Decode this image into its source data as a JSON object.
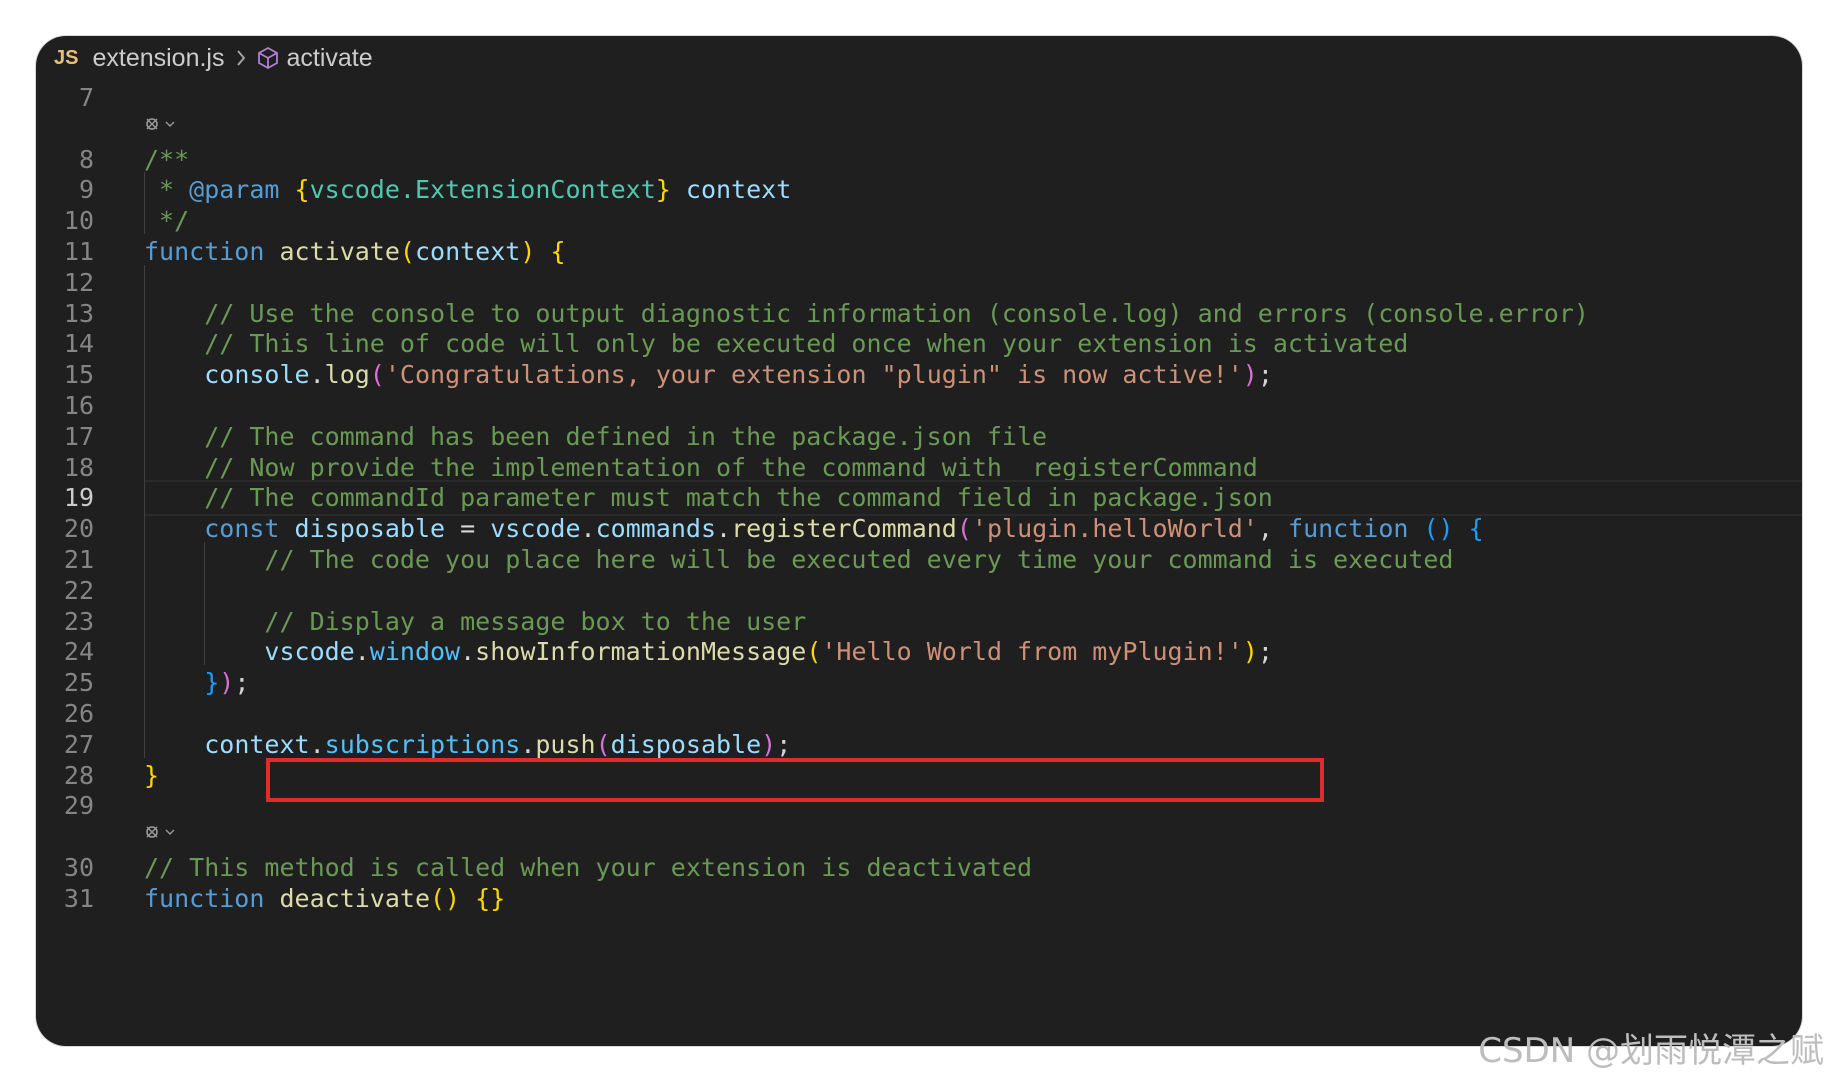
{
  "breadcrumb": {
    "badge": "JS",
    "file": "extension.js",
    "separator": "›",
    "symbol": "activate",
    "symbol_icon": "cube-icon"
  },
  "colors": {
    "background": "#1f1f1f",
    "comment": "#6a9955",
    "keyword": "#569cd6",
    "function": "#dcdcaa",
    "variable": "#9cdcfe",
    "string": "#ce9178",
    "type": "#4ec9b0",
    "highlight_box": "#e12a2a"
  },
  "codelens_icon": "codelens-icon",
  "lines": [
    {
      "n": "7",
      "tokens": []
    },
    {
      "n": "8",
      "tokens": [
        [
          "c-comment",
          "/**"
        ]
      ]
    },
    {
      "n": "9",
      "tokens": [
        [
          "c-comment",
          " * "
        ],
        [
          "c-kw",
          "@param"
        ],
        [
          "c-comment",
          " "
        ],
        [
          "c-p1",
          "{"
        ],
        [
          "c-type",
          "vscode.ExtensionContext"
        ],
        [
          "c-p1",
          "}"
        ],
        [
          "c-comment",
          " "
        ],
        [
          "c-var",
          "context"
        ]
      ]
    },
    {
      "n": "10",
      "tokens": [
        [
          "c-comment",
          " */"
        ]
      ]
    },
    {
      "n": "11",
      "tokens": [
        [
          "c-kw",
          "function"
        ],
        [
          "c-plain",
          " "
        ],
        [
          "c-fn",
          "activate"
        ],
        [
          "c-p1",
          "("
        ],
        [
          "c-var",
          "context"
        ],
        [
          "c-p1",
          ")"
        ],
        [
          "c-plain",
          " "
        ],
        [
          "c-p1",
          "{"
        ]
      ]
    },
    {
      "n": "12",
      "tokens": []
    },
    {
      "n": "13",
      "tokens": [
        [
          "c-plain",
          "    "
        ],
        [
          "c-comment",
          "// Use the console to output diagnostic information (console.log) and errors (console.error)"
        ]
      ]
    },
    {
      "n": "14",
      "tokens": [
        [
          "c-plain",
          "    "
        ],
        [
          "c-comment",
          "// This line of code will only be executed once when your extension is activated"
        ]
      ]
    },
    {
      "n": "15",
      "tokens": [
        [
          "c-plain",
          "    "
        ],
        [
          "c-var",
          "console"
        ],
        [
          "c-plain",
          "."
        ],
        [
          "c-fn",
          "log"
        ],
        [
          "c-p2",
          "("
        ],
        [
          "c-str",
          "'Congratulations, your extension \"plugin\" is now active!'"
        ],
        [
          "c-p2",
          ")"
        ],
        [
          "c-plain",
          ";"
        ]
      ]
    },
    {
      "n": "16",
      "tokens": []
    },
    {
      "n": "17",
      "tokens": [
        [
          "c-plain",
          "    "
        ],
        [
          "c-comment",
          "// The command has been defined in the package.json file"
        ]
      ]
    },
    {
      "n": "18",
      "tokens": [
        [
          "c-plain",
          "    "
        ],
        [
          "c-comment",
          "// Now provide the implementation of the command with  registerCommand"
        ]
      ]
    },
    {
      "n": "19",
      "tokens": [
        [
          "c-plain",
          "    "
        ],
        [
          "c-comment",
          "// The commandId parameter must match the command field in package.json"
        ]
      ],
      "active": true
    },
    {
      "n": "20",
      "tokens": [
        [
          "c-plain",
          "    "
        ],
        [
          "c-kw",
          "const"
        ],
        [
          "c-plain",
          " "
        ],
        [
          "c-var",
          "disposable"
        ],
        [
          "c-plain",
          " = "
        ],
        [
          "c-var",
          "vscode"
        ],
        [
          "c-plain",
          "."
        ],
        [
          "c-var",
          "commands"
        ],
        [
          "c-plain",
          "."
        ],
        [
          "c-fn",
          "registerCommand"
        ],
        [
          "c-p2",
          "("
        ],
        [
          "c-str",
          "'plugin.helloWorld'"
        ],
        [
          "c-plain",
          ", "
        ],
        [
          "c-kw",
          "function"
        ],
        [
          "c-plain",
          " "
        ],
        [
          "c-p3",
          "()"
        ],
        [
          "c-plain",
          " "
        ],
        [
          "c-p3",
          "{"
        ]
      ]
    },
    {
      "n": "21",
      "tokens": [
        [
          "c-plain",
          "        "
        ],
        [
          "c-comment",
          "// The code you place here will be executed every time your command is executed"
        ]
      ]
    },
    {
      "n": "22",
      "tokens": []
    },
    {
      "n": "23",
      "tokens": [
        [
          "c-plain",
          "        "
        ],
        [
          "c-comment",
          "// Display a message box to the user"
        ]
      ]
    },
    {
      "n": "24",
      "tokens": [
        [
          "c-plain",
          "        "
        ],
        [
          "c-var",
          "vscode"
        ],
        [
          "c-plain",
          "."
        ],
        [
          "c-prop",
          "window"
        ],
        [
          "c-plain",
          "."
        ],
        [
          "c-fn",
          "showInformationMessage"
        ],
        [
          "c-p1",
          "("
        ],
        [
          "c-str",
          "'Hello World from myPlugin!'"
        ],
        [
          "c-p1",
          ")"
        ],
        [
          "c-plain",
          ";"
        ]
      ]
    },
    {
      "n": "25",
      "tokens": [
        [
          "c-plain",
          "    "
        ],
        [
          "c-p3",
          "}"
        ],
        [
          "c-p2",
          ")"
        ],
        [
          "c-plain",
          ";"
        ]
      ]
    },
    {
      "n": "26",
      "tokens": []
    },
    {
      "n": "27",
      "tokens": [
        [
          "c-plain",
          "    "
        ],
        [
          "c-var",
          "context"
        ],
        [
          "c-plain",
          "."
        ],
        [
          "c-prop",
          "subscriptions"
        ],
        [
          "c-plain",
          "."
        ],
        [
          "c-fn",
          "push"
        ],
        [
          "c-p2",
          "("
        ],
        [
          "c-var",
          "disposable"
        ],
        [
          "c-p2",
          ")"
        ],
        [
          "c-plain",
          ";"
        ]
      ]
    },
    {
      "n": "28",
      "tokens": [
        [
          "c-p1",
          "}"
        ]
      ]
    },
    {
      "n": "29",
      "tokens": []
    },
    {
      "n": "30",
      "tokens": [
        [
          "c-comment",
          "// This method is called when your extension is deactivated"
        ]
      ]
    },
    {
      "n": "31",
      "tokens": [
        [
          "c-kw",
          "function"
        ],
        [
          "c-plain",
          " "
        ],
        [
          "c-fn",
          "deactivate"
        ],
        [
          "c-p1",
          "()"
        ],
        [
          "c-plain",
          " "
        ],
        [
          "c-p1",
          "{}"
        ]
      ]
    }
  ],
  "watermark": "CSDN @划雨悦潭之赋"
}
